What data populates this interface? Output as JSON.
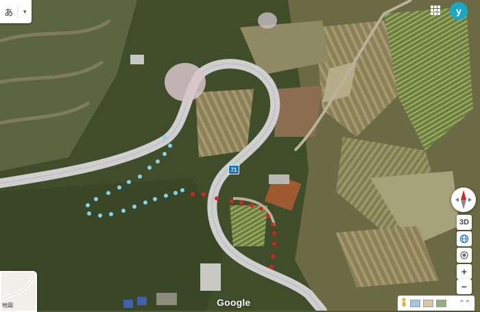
{
  "ime": {
    "mode_glyph": "あ",
    "caret": "▾"
  },
  "account": {
    "avatar_letter": "y"
  },
  "road": {
    "route_number": "71"
  },
  "controls": {
    "view_3d": "3D",
    "zoom_in": "+",
    "zoom_out": "−"
  },
  "inset": {
    "label": "地図"
  },
  "branding": {
    "logo": "Google"
  },
  "colors": {
    "blue_route": "#7ed6f2",
    "red_route": "#e02020",
    "road": "#d8d8d8",
    "vegetation": "#3e4f2b",
    "fields": "#8a8a5a"
  },
  "icons": [
    "apps-grid-icon",
    "compass-icon",
    "globe-icon",
    "location-icon",
    "pegman-icon",
    "expand-icon"
  ]
}
